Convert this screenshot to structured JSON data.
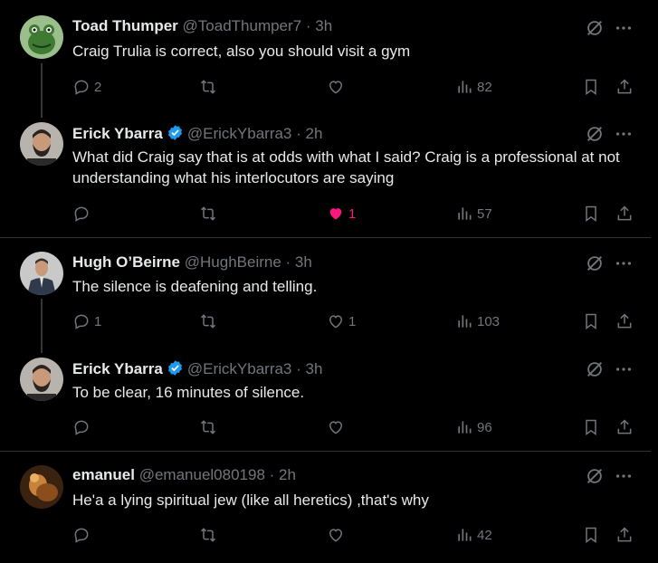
{
  "tweets": [
    {
      "name": "Toad Thumper",
      "handle": "@ToadThumper7",
      "time": "· 3h",
      "verified": false,
      "text": "Craig Trulia is correct, also you should visit a gym",
      "replies": "2",
      "retweets": "",
      "likes": "",
      "views": "82",
      "avatar_icon": "frog-avatar"
    },
    {
      "name": "Erick Ybarra",
      "handle": "@ErickYbarra3",
      "time": "· 2h",
      "verified": true,
      "text": "What did Craig say that is at odds with what I said? Craig is a professional at not understanding what his interlocutors are saying",
      "replies": "",
      "retweets": "",
      "likes": "1",
      "liked": true,
      "views": "57",
      "avatar_icon": "bearded-man-avatar"
    },
    {
      "name": "Hugh O’Beirne",
      "handle": "@HughBeirne",
      "time": "· 3h",
      "verified": false,
      "text": "The silence is deafening and telling.",
      "replies": "1",
      "retweets": "",
      "likes": "1",
      "views": "103",
      "avatar_icon": "suited-man-avatar"
    },
    {
      "name": "Erick Ybarra",
      "handle": "@ErickYbarra3",
      "time": "· 3h",
      "verified": true,
      "text": "To be clear, 16 minutes of silence.",
      "replies": "",
      "retweets": "",
      "likes": "",
      "views": "96",
      "avatar_icon": "bearded-man-avatar"
    },
    {
      "name": "emanuel",
      "handle": "@emanuel080198",
      "time": "· 2h",
      "verified": false,
      "text": "He'a a lying spiritual jew (like all heretics) ,that's why",
      "replies": "",
      "retweets": "",
      "likes": "",
      "views": "42",
      "avatar_icon": "painting-avatar"
    }
  ],
  "colors": {
    "background": "#000000",
    "text": "#e7e9ea",
    "secondary": "#71767b",
    "divider": "#2f3336",
    "like": "#f91880",
    "verified": "#1d9bf0"
  }
}
